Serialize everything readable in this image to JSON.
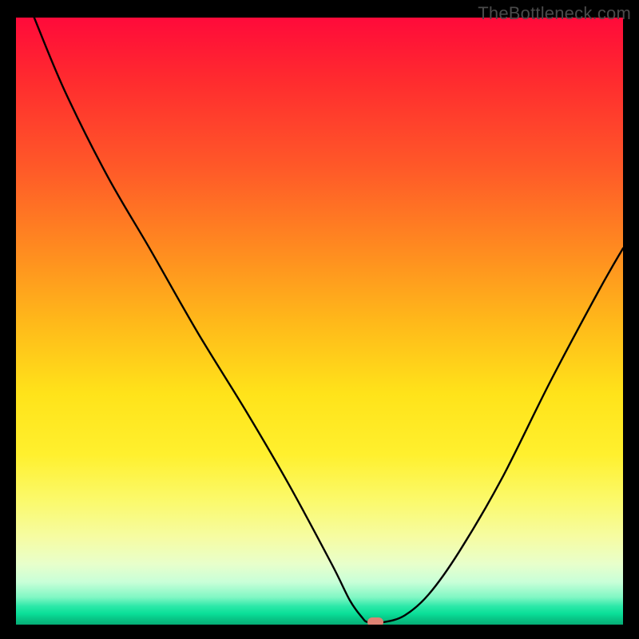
{
  "watermark": "TheBottleneck.com",
  "chart_data": {
    "type": "line",
    "title": "",
    "xlabel": "",
    "ylabel": "",
    "xlim": [
      0,
      100
    ],
    "ylim": [
      0,
      100
    ],
    "background": "rainbow_gradient_red_to_green_vertical",
    "series": [
      {
        "name": "bottleneck-curve",
        "x": [
          3,
          8,
          15,
          22,
          30,
          38,
          45,
          52,
          55,
          57,
          58,
          60.5,
          64,
          68,
          73,
          80,
          88,
          96,
          100
        ],
        "y": [
          100,
          88,
          74,
          62,
          48,
          35,
          23,
          10,
          4,
          1.2,
          0.4,
          0.4,
          1.5,
          5,
          12,
          24,
          40,
          55,
          62
        ]
      }
    ],
    "marker": {
      "x": 59.2,
      "y": 0.4,
      "color": "#de8374"
    }
  }
}
